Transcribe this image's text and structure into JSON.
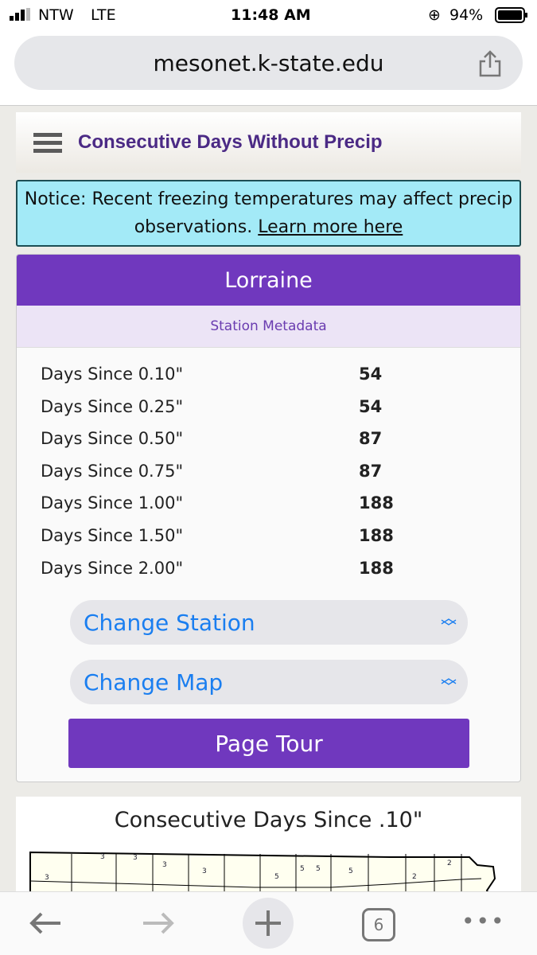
{
  "status_bar": {
    "carrier": "NTW",
    "network": "LTE",
    "time": "11:48 AM",
    "battery": "94%"
  },
  "browser": {
    "url": "mesonet.k-state.edu",
    "tab_count": "6"
  },
  "header": {
    "title": "Consecutive Days Without Precip"
  },
  "notice": {
    "text": "Notice: Recent freezing temperatures may affect precip observations. ",
    "link": "Learn more here",
    "color": "#a3eaf7"
  },
  "station": {
    "name": "Lorraine",
    "metadata_label": "Station Metadata"
  },
  "rows": [
    {
      "label": "Days Since 0.10\"",
      "value": "54"
    },
    {
      "label": "Days Since 0.25\"",
      "value": "54"
    },
    {
      "label": "Days Since 0.50\"",
      "value": "87"
    },
    {
      "label": "Days Since 0.75\"",
      "value": "87"
    },
    {
      "label": "Days Since 1.00\"",
      "value": "188"
    },
    {
      "label": "Days Since 1.50\"",
      "value": "188"
    },
    {
      "label": "Days Since 2.00\"",
      "value": "188"
    }
  ],
  "controls": {
    "change_station": "Change Station",
    "change_map": "Change Map",
    "page_tour": "Page Tour"
  },
  "map": {
    "title": "Consecutive Days Since .10\"",
    "labels": [
      "3",
      "3",
      "3",
      "3",
      "3",
      "5",
      "5",
      "5",
      "5",
      "2",
      "2"
    ]
  },
  "colors": {
    "accent": "#7038be",
    "title": "#4b2a85",
    "link": "#1a7ef0"
  }
}
